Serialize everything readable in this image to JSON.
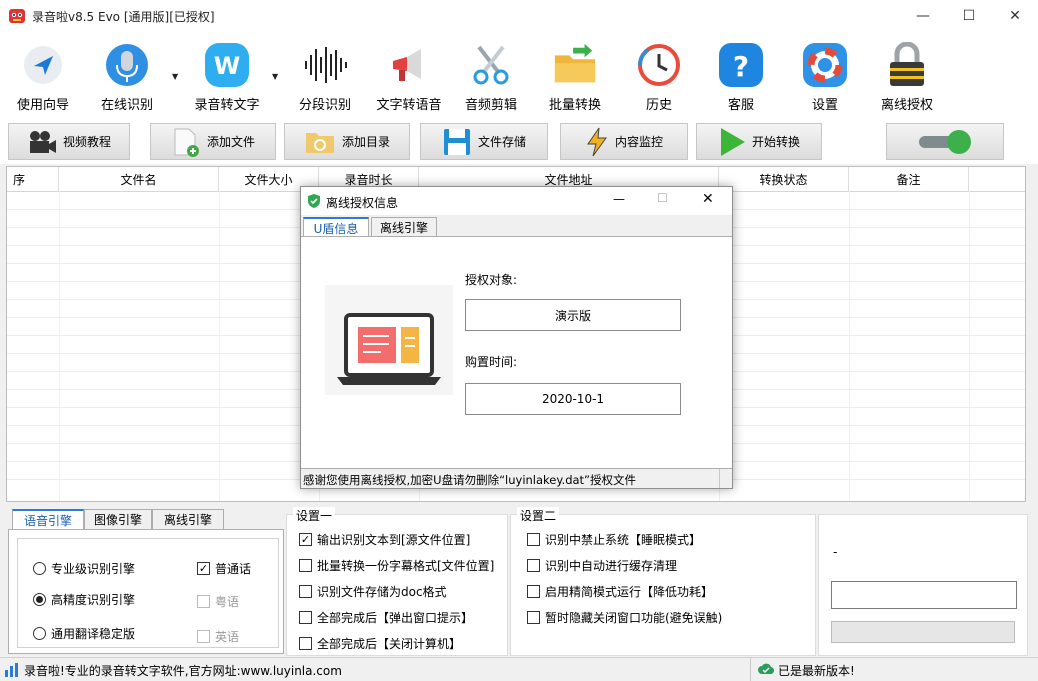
{
  "window": {
    "title": "录音啦v8.5 Evo [通用版][已授权]",
    "minimize": "—",
    "maximize": "☐",
    "close": "✕"
  },
  "toolbar": {
    "items": [
      {
        "label": "使用向导",
        "icon": "navigation-arrow-icon"
      },
      {
        "label": "在线识别",
        "icon": "microphone-icon"
      },
      {
        "label": "录音转文字",
        "icon": "w-logo-icon"
      },
      {
        "label": "分段识别",
        "icon": "waveform-icon"
      },
      {
        "label": "文字转语音",
        "icon": "megaphone-icon"
      },
      {
        "label": "音频剪辑",
        "icon": "scissors-icon"
      },
      {
        "label": "批量转换",
        "icon": "folder-icon"
      },
      {
        "label": "历史",
        "icon": "history-clock-icon"
      },
      {
        "label": "客服",
        "icon": "help-icon"
      },
      {
        "label": "设置",
        "icon": "lifebuoy-icon"
      },
      {
        "label": "离线授权",
        "icon": "padlock-icon"
      }
    ]
  },
  "buttons": {
    "video_tutorial": "视频教程",
    "add_file": "添加文件",
    "add_folder": "添加目录",
    "file_storage": "文件存储",
    "content_monitor": "内容监控",
    "start_convert": "开始转换"
  },
  "table": {
    "headers": [
      "序",
      "文件名",
      "文件大小",
      "录音时长",
      "文件地址",
      "转换状态",
      "备注"
    ]
  },
  "dialog": {
    "title": "离线授权信息",
    "tabs": [
      "U盾信息",
      "离线引擎"
    ],
    "auth_label": "授权对象:",
    "auth_value": "演示版",
    "purchase_label": "购置时间:",
    "purchase_value": "2020-10-1",
    "status": "感谢您使用离线授权,加密U盘请勿删除“luyinlakey.dat”授权文件"
  },
  "engine": {
    "tabs": [
      "语音引擎",
      "图像引擎",
      "离线引擎"
    ],
    "options": [
      {
        "label": "专业级识别引擎",
        "selected": false
      },
      {
        "label": "高精度识别引擎",
        "selected": true
      },
      {
        "label": "通用翻译稳定版",
        "selected": false
      }
    ],
    "languages": [
      {
        "label": "普通话",
        "checked": true,
        "enabled": true
      },
      {
        "label": "粤语",
        "checked": false,
        "enabled": false
      },
      {
        "label": "英语",
        "checked": false,
        "enabled": false
      }
    ]
  },
  "settings1": {
    "title": "设置一",
    "items": [
      {
        "label": "输出识别文本到[源文件位置]",
        "checked": true
      },
      {
        "label": "批量转换一份字幕格式[文件位置]",
        "checked": false
      },
      {
        "label": "识别文件存储为doc格式",
        "checked": false
      },
      {
        "label": "全部完成后【弹出窗口提示】",
        "checked": false
      },
      {
        "label": "全部完成后【关闭计算机】",
        "checked": false
      }
    ]
  },
  "settings2": {
    "title": "设置二",
    "items": [
      {
        "label": "识别中禁止系统【睡眠模式】",
        "checked": false
      },
      {
        "label": "识别中自动进行缓存清理",
        "checked": false
      },
      {
        "label": "启用精简模式运行【降低功耗】",
        "checked": false
      },
      {
        "label": "暂时隐藏关闭窗口功能(避免误触)",
        "checked": false
      }
    ]
  },
  "side_panel": {
    "dash": "-"
  },
  "statusbar": {
    "left": "录音啦!专业的录音转文字软件,官方网址:www.luyinla.com",
    "right": "已是最新版本!"
  }
}
